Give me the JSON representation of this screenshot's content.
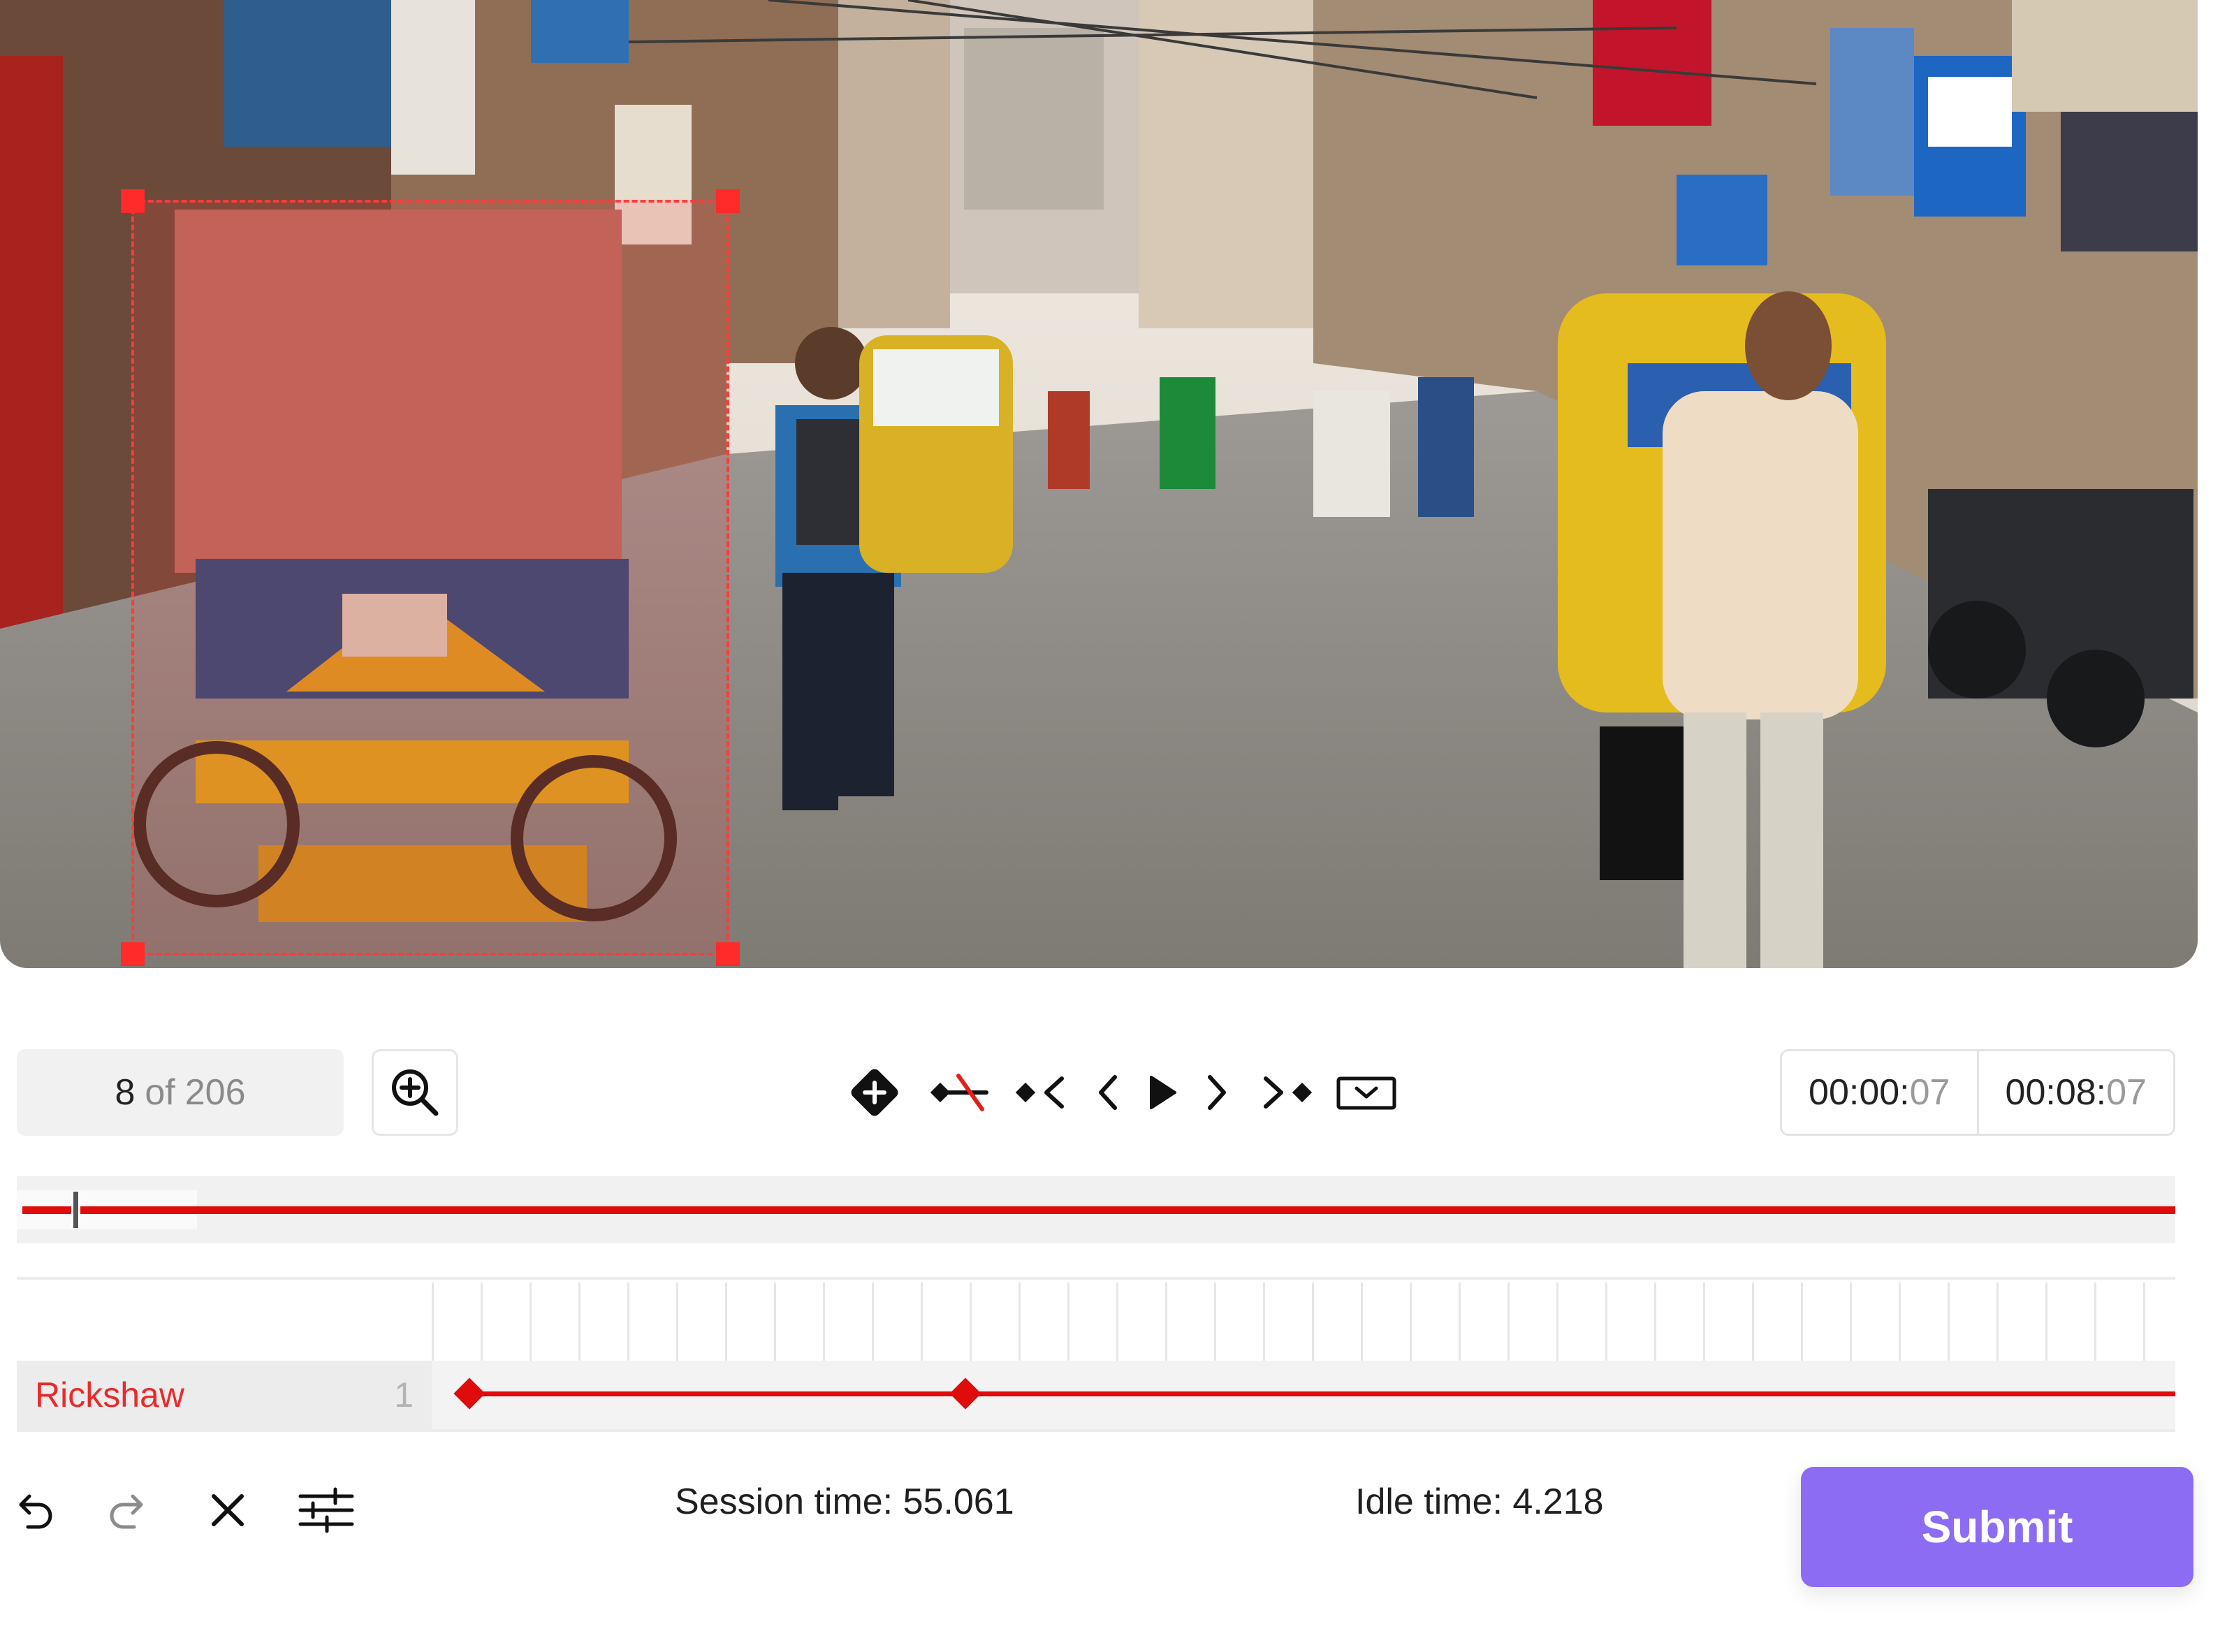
{
  "video": {
    "annotation": {
      "label": "Rickshaw"
    }
  },
  "toolbar": {
    "frame_current": "8",
    "frame_of": "of",
    "frame_total": "206",
    "zoom_icon": "zoom-in-icon",
    "controls": [
      "add-keyframe-icon",
      "remove-keyframe-icon",
      "previous-keyframe-icon",
      "previous-frame-icon",
      "play-icon",
      "next-frame-icon",
      "next-keyframe-icon",
      "dropdown-icon"
    ],
    "time_current_main": "00:00:",
    "time_current_frac": "07",
    "time_total_main": "00:08:",
    "time_total_frac": "07"
  },
  "timeline": {
    "playhead_frame": 8,
    "tracks": [
      {
        "name": "Rickshaw",
        "count": "1",
        "keyframes": [
          1,
          52
        ]
      }
    ]
  },
  "footer": {
    "icons": [
      "undo-icon",
      "redo-icon",
      "close-icon",
      "settings-sliders-icon"
    ],
    "session_time": "Session time: 55.061",
    "idle_time": "Idle time: 4.218",
    "submit_label": "Submit"
  },
  "colors": {
    "annotation": "#e00b0b",
    "submit": "#8c6cf2"
  }
}
